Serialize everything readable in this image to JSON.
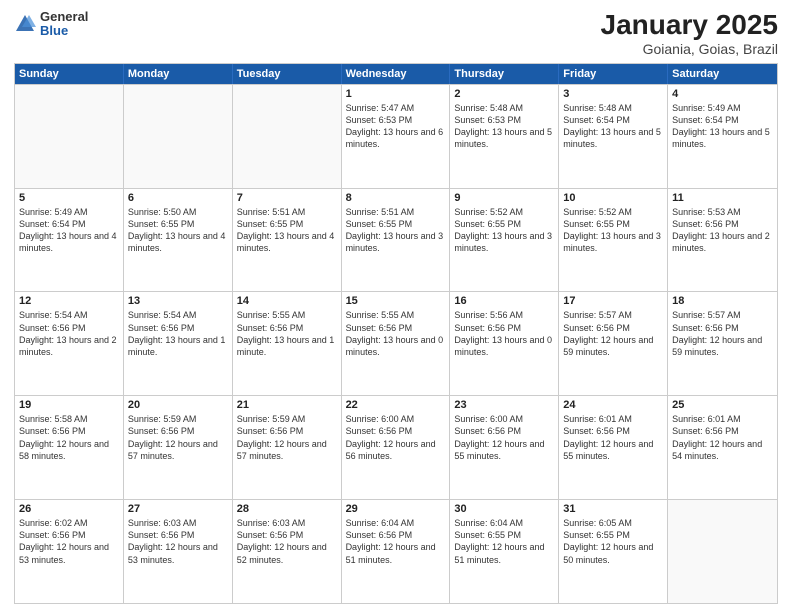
{
  "header": {
    "logo": {
      "general": "General",
      "blue": "Blue"
    },
    "title": "January 2025",
    "subtitle": "Goiania, Goias, Brazil"
  },
  "weekdays": [
    "Sunday",
    "Monday",
    "Tuesday",
    "Wednesday",
    "Thursday",
    "Friday",
    "Saturday"
  ],
  "weeks": [
    [
      {
        "day": "",
        "empty": true
      },
      {
        "day": "",
        "empty": true
      },
      {
        "day": "",
        "empty": true
      },
      {
        "day": "1",
        "sunrise": "5:47 AM",
        "sunset": "6:53 PM",
        "daylight": "13 hours and 6 minutes."
      },
      {
        "day": "2",
        "sunrise": "5:48 AM",
        "sunset": "6:53 PM",
        "daylight": "13 hours and 5 minutes."
      },
      {
        "day": "3",
        "sunrise": "5:48 AM",
        "sunset": "6:54 PM",
        "daylight": "13 hours and 5 minutes."
      },
      {
        "day": "4",
        "sunrise": "5:49 AM",
        "sunset": "6:54 PM",
        "daylight": "13 hours and 5 minutes."
      }
    ],
    [
      {
        "day": "5",
        "sunrise": "5:49 AM",
        "sunset": "6:54 PM",
        "daylight": "13 hours and 4 minutes."
      },
      {
        "day": "6",
        "sunrise": "5:50 AM",
        "sunset": "6:55 PM",
        "daylight": "13 hours and 4 minutes."
      },
      {
        "day": "7",
        "sunrise": "5:51 AM",
        "sunset": "6:55 PM",
        "daylight": "13 hours and 4 minutes."
      },
      {
        "day": "8",
        "sunrise": "5:51 AM",
        "sunset": "6:55 PM",
        "daylight": "13 hours and 3 minutes."
      },
      {
        "day": "9",
        "sunrise": "5:52 AM",
        "sunset": "6:55 PM",
        "daylight": "13 hours and 3 minutes."
      },
      {
        "day": "10",
        "sunrise": "5:52 AM",
        "sunset": "6:55 PM",
        "daylight": "13 hours and 3 minutes."
      },
      {
        "day": "11",
        "sunrise": "5:53 AM",
        "sunset": "6:56 PM",
        "daylight": "13 hours and 2 minutes."
      }
    ],
    [
      {
        "day": "12",
        "sunrise": "5:54 AM",
        "sunset": "6:56 PM",
        "daylight": "13 hours and 2 minutes."
      },
      {
        "day": "13",
        "sunrise": "5:54 AM",
        "sunset": "6:56 PM",
        "daylight": "13 hours and 1 minute."
      },
      {
        "day": "14",
        "sunrise": "5:55 AM",
        "sunset": "6:56 PM",
        "daylight": "13 hours and 1 minute."
      },
      {
        "day": "15",
        "sunrise": "5:55 AM",
        "sunset": "6:56 PM",
        "daylight": "13 hours and 0 minutes."
      },
      {
        "day": "16",
        "sunrise": "5:56 AM",
        "sunset": "6:56 PM",
        "daylight": "13 hours and 0 minutes."
      },
      {
        "day": "17",
        "sunrise": "5:57 AM",
        "sunset": "6:56 PM",
        "daylight": "12 hours and 59 minutes."
      },
      {
        "day": "18",
        "sunrise": "5:57 AM",
        "sunset": "6:56 PM",
        "daylight": "12 hours and 59 minutes."
      }
    ],
    [
      {
        "day": "19",
        "sunrise": "5:58 AM",
        "sunset": "6:56 PM",
        "daylight": "12 hours and 58 minutes."
      },
      {
        "day": "20",
        "sunrise": "5:59 AM",
        "sunset": "6:56 PM",
        "daylight": "12 hours and 57 minutes."
      },
      {
        "day": "21",
        "sunrise": "5:59 AM",
        "sunset": "6:56 PM",
        "daylight": "12 hours and 57 minutes."
      },
      {
        "day": "22",
        "sunrise": "6:00 AM",
        "sunset": "6:56 PM",
        "daylight": "12 hours and 56 minutes."
      },
      {
        "day": "23",
        "sunrise": "6:00 AM",
        "sunset": "6:56 PM",
        "daylight": "12 hours and 55 minutes."
      },
      {
        "day": "24",
        "sunrise": "6:01 AM",
        "sunset": "6:56 PM",
        "daylight": "12 hours and 55 minutes."
      },
      {
        "day": "25",
        "sunrise": "6:01 AM",
        "sunset": "6:56 PM",
        "daylight": "12 hours and 54 minutes."
      }
    ],
    [
      {
        "day": "26",
        "sunrise": "6:02 AM",
        "sunset": "6:56 PM",
        "daylight": "12 hours and 53 minutes."
      },
      {
        "day": "27",
        "sunrise": "6:03 AM",
        "sunset": "6:56 PM",
        "daylight": "12 hours and 53 minutes."
      },
      {
        "day": "28",
        "sunrise": "6:03 AM",
        "sunset": "6:56 PM",
        "daylight": "12 hours and 52 minutes."
      },
      {
        "day": "29",
        "sunrise": "6:04 AM",
        "sunset": "6:56 PM",
        "daylight": "12 hours and 51 minutes."
      },
      {
        "day": "30",
        "sunrise": "6:04 AM",
        "sunset": "6:55 PM",
        "daylight": "12 hours and 51 minutes."
      },
      {
        "day": "31",
        "sunrise": "6:05 AM",
        "sunset": "6:55 PM",
        "daylight": "12 hours and 50 minutes."
      },
      {
        "day": "",
        "empty": true
      }
    ]
  ]
}
